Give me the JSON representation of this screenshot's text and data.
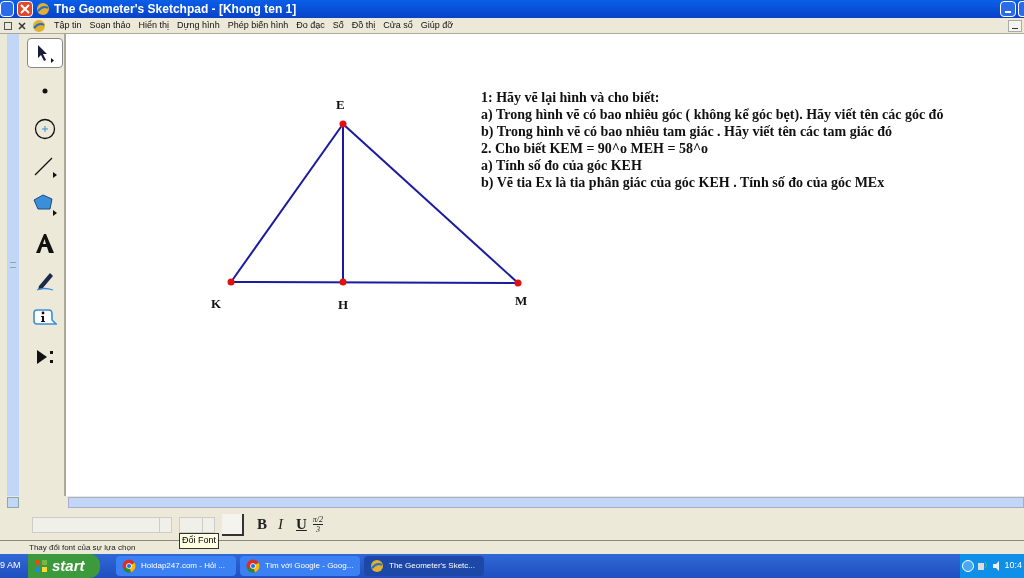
{
  "window": {
    "title": "The Geometer's Sketchpad - [Khong ten 1]"
  },
  "menu": [
    "Tập tin",
    "Soạn thảo",
    "Hiển thị",
    "Dựng hình",
    "Phép biến hình",
    "Đo đạc",
    "Số",
    "Đồ thị",
    "Cửa sổ",
    "Giúp đỡ"
  ],
  "tools": [
    {
      "kind": "arrow",
      "selected": true
    },
    {
      "kind": "point",
      "selected": false
    },
    {
      "kind": "compass",
      "selected": false
    },
    {
      "kind": "straightedge",
      "selected": false
    },
    {
      "kind": "polygon",
      "selected": false
    },
    {
      "kind": "text",
      "selected": false
    },
    {
      "kind": "marker",
      "selected": false
    },
    {
      "kind": "info",
      "selected": false
    },
    {
      "kind": "custom",
      "selected": false
    }
  ],
  "figure": {
    "points": [
      {
        "label": "E"
      },
      {
        "label": "K"
      },
      {
        "label": "H"
      },
      {
        "label": "M"
      }
    ]
  },
  "caption_lines": [
    "1: Hãy vẽ lại hình và cho biết:",
    "a) Trong hình vẽ có bao nhiêu góc ( không kể góc bẹt). Hãy viết tên các góc đó",
    "b) Trong hình vẽ có bao nhiêu tam giác . Hãy viết tên các tam giác đó",
    "2. Cho biết KEM = 90^o MEH = 58^o",
    "a) Tính số đo của góc KEH",
    "b) Vẽ tia Ex là tia phân giác của góc KEH . Tính số đo của góc MEx"
  ],
  "text_toolbar": {
    "bold": "B",
    "italic": "I",
    "underline": "U",
    "symbol": {
      "numerator": "π/2",
      "denominator": "3"
    },
    "tooltip": "Đổi Font"
  },
  "status_bar": "Thay đổi font của sự lựa chọn",
  "taskbar": {
    "clock_left": "9 AM",
    "start": "start",
    "tasks": [
      {
        "label": "Hoidap247.com - Hỏi ...",
        "kind": "chrome",
        "selected": false
      },
      {
        "label": "Tìm với Google - Goog...",
        "kind": "chrome",
        "selected": false
      },
      {
        "label": "The Geometer's Sketc...",
        "kind": "sketchpad",
        "selected": true
      }
    ],
    "clock": "10:4"
  }
}
